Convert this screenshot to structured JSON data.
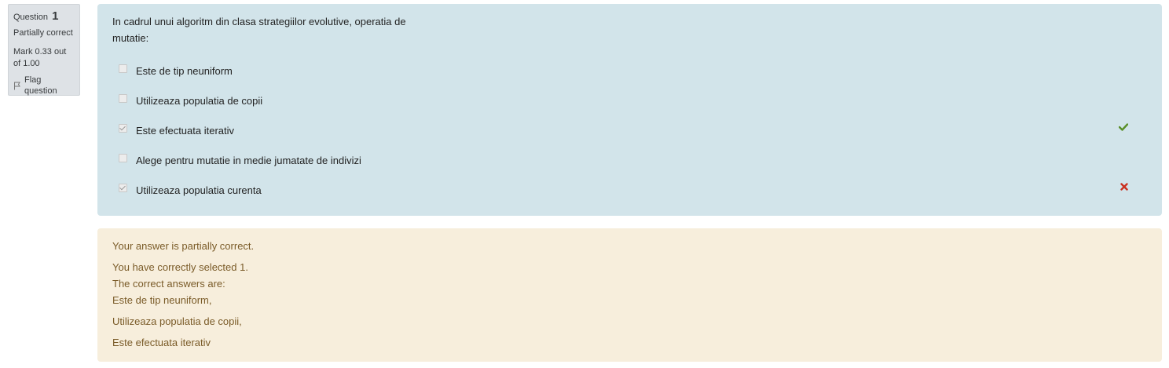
{
  "info": {
    "question_label": "Question",
    "question_number": "1",
    "state": "Partially correct",
    "grade": "Mark 0.33 out of 1.00",
    "flag_label": "Flag question"
  },
  "question": {
    "text": "In cadrul unui algoritm din clasa strategiilor evolutive, operatia de mutatie:",
    "options": [
      {
        "label": "Este de tip neuniform",
        "checked": false,
        "mark": ""
      },
      {
        "label": "Utilizeaza populatia de copii",
        "checked": false,
        "mark": ""
      },
      {
        "label": "Este efectuata iterativ",
        "checked": true,
        "mark": "correct"
      },
      {
        "label": "Alege pentru mutatie in medie jumatate de indivizi",
        "checked": false,
        "mark": ""
      },
      {
        "label": "Utilizeaza populatia curenta",
        "checked": true,
        "mark": "incorrect"
      }
    ]
  },
  "feedback": {
    "general": "Your answer is partially correct.",
    "selected": "You have correctly selected 1.",
    "correct_intro": "The correct answers are:",
    "answers": [
      "Este de tip neuniform,",
      "Utilizeaza populatia de copii,",
      "Este efectuata iterativ"
    ]
  },
  "colors": {
    "correct": "#5a8f29",
    "incorrect": "#ca3120",
    "formulation_bg": "#d2e4ea",
    "feedback_bg": "#f7eedc"
  },
  "icons": {
    "correct": "check-icon",
    "incorrect": "cross-icon",
    "flag": "flag-icon"
  }
}
